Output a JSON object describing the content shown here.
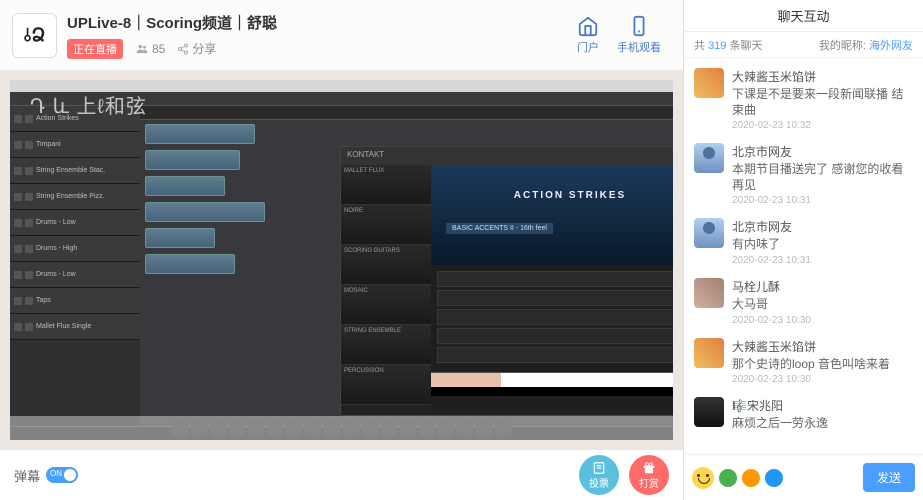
{
  "header": {
    "logo_text": "⫰Ձ",
    "title": "UPLive-8｜Scoring频道｜舒聪",
    "live_badge": "正在直播",
    "viewer_count": "85",
    "share_label": "分享",
    "portal_label": "门户",
    "mobile_label": "手机观看"
  },
  "player": {
    "watermark": "Դ և 上ℓ和弦",
    "kontakt": {
      "window_title": "KONTAKT",
      "instrument_title": "ACTION STRIKES",
      "instrument_sub": "BASIC ACCENTS II - 16th feel",
      "libs": [
        "MALLET FLUX",
        "NOIRE",
        "SCORING GUITARS",
        "MOSAIC",
        "STRING ENSEMBLE",
        "PERCUSSION"
      ]
    },
    "tracks": [
      "Action Strikes",
      "Timpani",
      "String Ensemble Stac.",
      "String Ensemble Pizz.",
      "Drums - Low",
      "Drums - High",
      "Drums - Low",
      "Taps",
      "Mallet Flux Single"
    ]
  },
  "bottom": {
    "danmu_label": "弹幕",
    "toggle_state": "ON",
    "vote_label": "投票",
    "tip_label": "打赏"
  },
  "chat": {
    "title": "聊天互动",
    "count_prefix": "共",
    "count_num": "319",
    "count_suffix": "条聊天",
    "nick_label": "我的昵称:",
    "nick_value": "海外网友",
    "messages": [
      {
        "avatar": "a1",
        "user": "大辣酱玉米馅饼",
        "text": "下课是不是要来一段新闻联播 结束曲",
        "time": "2020-02-23 10:32"
      },
      {
        "avatar": "a2",
        "user": "北京市网友",
        "text": "本期节目播送完了 感谢您的收看 再见",
        "time": "2020-02-23 10:31"
      },
      {
        "avatar": "a2",
        "user": "北京市网友",
        "text": "有内味了",
        "time": "2020-02-23 10:31"
      },
      {
        "avatar": "a3",
        "user": "马栓儿酥",
        "text": "大马哥",
        "time": "2020-02-23 10:30"
      },
      {
        "avatar": "a1",
        "user": "大辣酱玉米馅饼",
        "text": "那个史诗的loop 音色叫啥来着",
        "time": "2020-02-23 10:30"
      },
      {
        "avatar": "a4",
        "user": "🎼宋兆阳",
        "text": "麻烦之后一劳永逸",
        "time": ""
      }
    ],
    "send_label": "发送"
  }
}
